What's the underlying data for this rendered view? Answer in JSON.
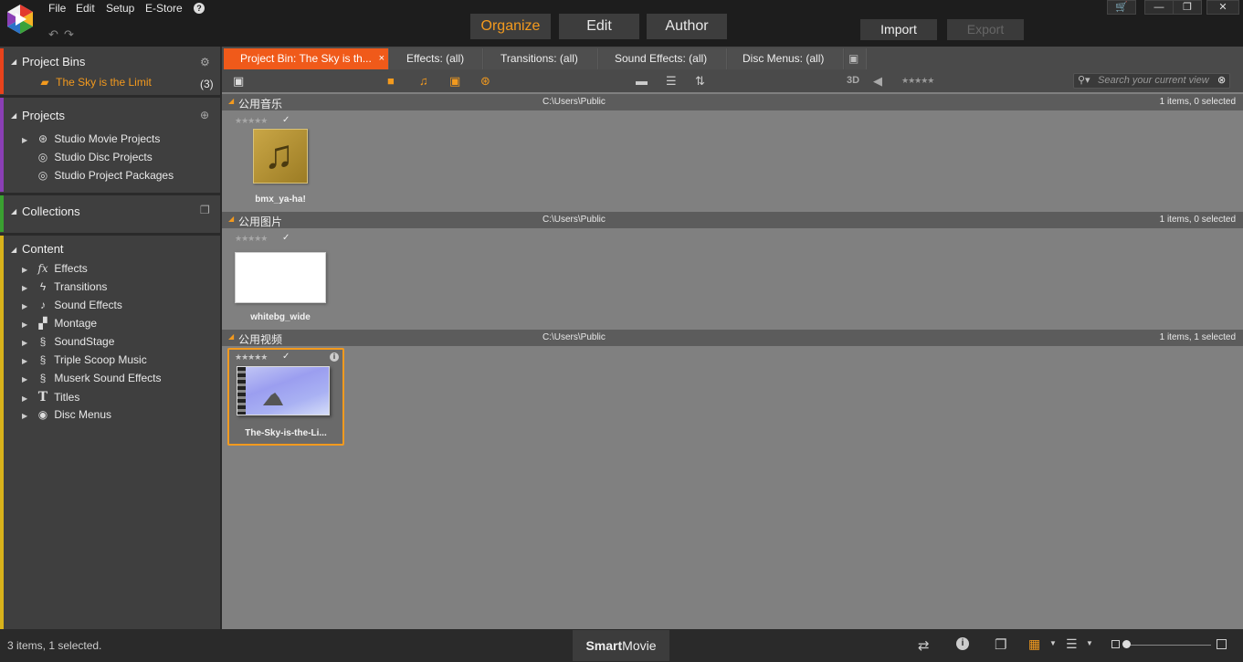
{
  "menu": {
    "file": "File",
    "edit": "Edit",
    "setup": "Setup",
    "estore": "E-Store",
    "help": "?"
  },
  "modes": {
    "organize": "Organize",
    "edit": "Edit",
    "author": "Author"
  },
  "actions": {
    "import": "Import",
    "export": "Export"
  },
  "window": {
    "cart": "🛒",
    "minimize": "—",
    "restore": "❐",
    "close": "✕"
  },
  "left": {
    "project_bins": {
      "title": "Project Bins",
      "items": [
        {
          "label": "The Sky is the Limit",
          "count": "(3)"
        }
      ]
    },
    "projects": {
      "title": "Projects",
      "items": [
        {
          "label": "Studio Movie Projects"
        },
        {
          "label": "Studio Disc Projects"
        },
        {
          "label": "Studio Project Packages"
        }
      ]
    },
    "collections": {
      "title": "Collections"
    },
    "content": {
      "title": "Content",
      "items": [
        {
          "label": "Effects",
          "icon": "fx-icon"
        },
        {
          "label": "Transitions",
          "icon": "bolt-icon"
        },
        {
          "label": "Sound Effects",
          "icon": "note-icon"
        },
        {
          "label": "Montage",
          "icon": "montage-icon"
        },
        {
          "label": "SoundStage",
          "icon": "clef-icon"
        },
        {
          "label": "Triple Scoop Music",
          "icon": "clef-icon"
        },
        {
          "label": "Muserk Sound Effects",
          "icon": "clef-icon"
        },
        {
          "label": "Titles",
          "icon": "t-icon"
        },
        {
          "label": "Disc Menus",
          "icon": "disc-icon"
        }
      ]
    }
  },
  "tabs": [
    {
      "label": "Project Bin: The Sky is th...",
      "close": "×"
    },
    {
      "label": "Effects: (all)"
    },
    {
      "label": "Transitions: (all)"
    },
    {
      "label": "Sound Effects: (all)"
    },
    {
      "label": "Disc Menus: (all)"
    }
  ],
  "toolbar": {
    "three_d": "3D",
    "search_placeholder": "Search your current view"
  },
  "groups": [
    {
      "name": "公用音乐",
      "path": "C:\\Users\\Public",
      "count": "1 items, 0 selected",
      "item": "bmx_ya-ha!"
    },
    {
      "name": "公用图片",
      "path": "C:\\Users\\Public",
      "count": "1 items, 0 selected",
      "item": "whitebg_wide"
    },
    {
      "name": "公用视频",
      "path": "C:\\Users\\Public",
      "count": "1 items, 1 selected",
      "item": "The-Sky-is-the-Li..."
    }
  ],
  "stars": "★★★★★",
  "check": "✓",
  "status": {
    "text": "3 items, 1 selected.",
    "smart": "Smart",
    "movie": "Movie"
  },
  "colors": {
    "accent": "#f39a1e",
    "active_tab": "#f05a1a",
    "bins_bar": "#e8431c",
    "projects_bar": "#8a3fb5",
    "collections_bar": "#3aa031",
    "content_bar": "#d8b21b"
  }
}
